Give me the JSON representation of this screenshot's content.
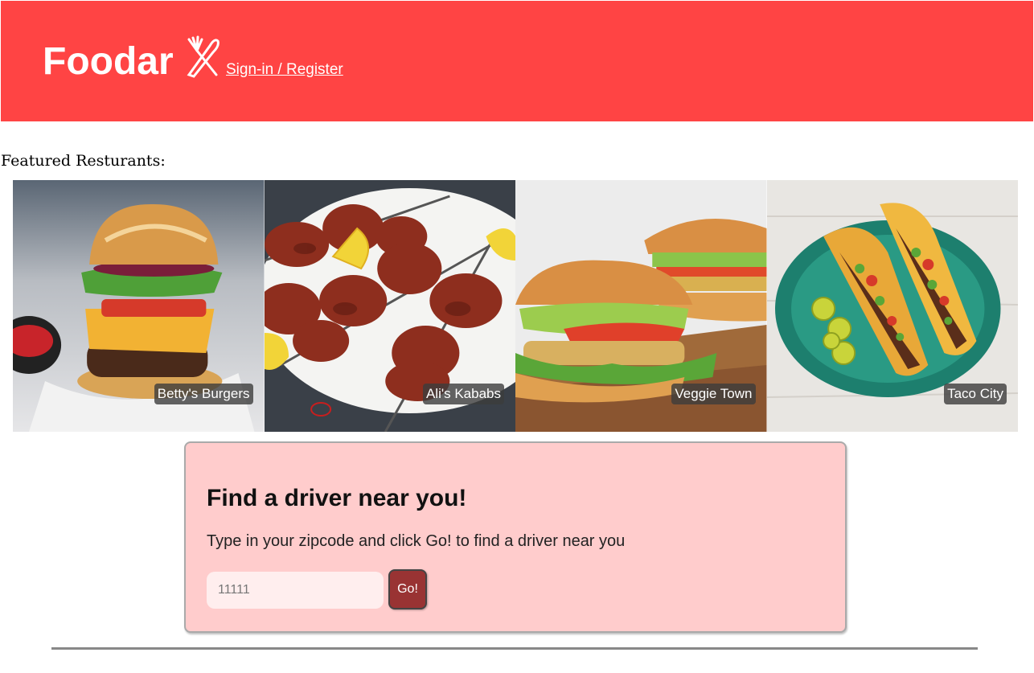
{
  "header": {
    "brand": "Foodar",
    "signin_label": "Sign-in / Register",
    "bg_color": "#ff4444"
  },
  "featured": {
    "label": "Featured Resturants:",
    "restaurants": [
      {
        "name": "Betty's Burgers",
        "icon": "burger-image"
      },
      {
        "name": "Ali's Kababs",
        "icon": "kabab-image"
      },
      {
        "name": "Veggie Town",
        "icon": "veggie-burger-image"
      },
      {
        "name": "Taco City",
        "icon": "taco-image"
      }
    ]
  },
  "driver": {
    "title": "Find a driver near you!",
    "description": "Type in your zipcode and click Go! to find a driver near you",
    "zip_placeholder": "11111",
    "go_label": "Go!",
    "panel_color": "#ffcccc",
    "button_color": "#993333"
  }
}
